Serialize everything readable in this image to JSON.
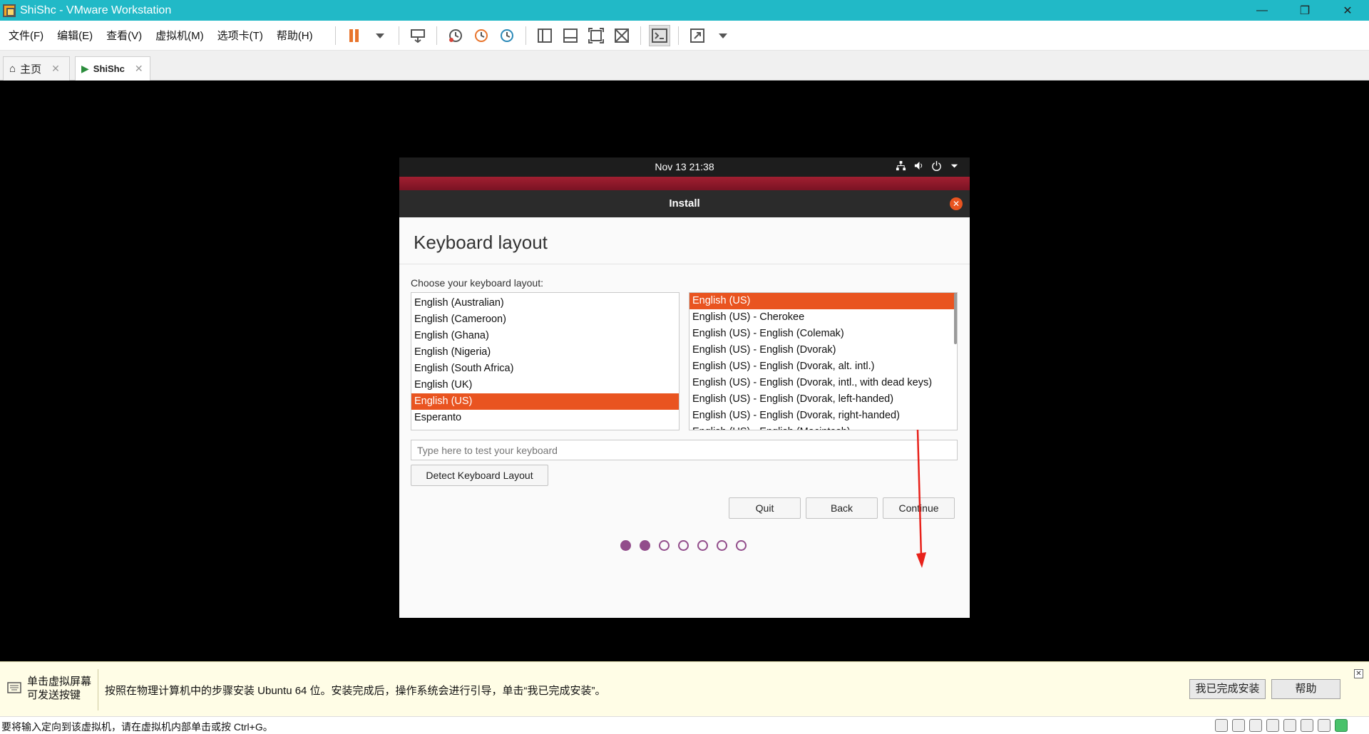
{
  "window": {
    "title": "ShiShc - VMware Workstation"
  },
  "menu": [
    "文件(F)",
    "编辑(E)",
    "查看(V)",
    "虚拟机(M)",
    "选项卡(T)",
    "帮助(H)"
  ],
  "tabs": {
    "home": "主页",
    "vm": "ShiShc"
  },
  "guest": {
    "clock": "Nov 13  21:38",
    "installer": {
      "header": "Install",
      "page_title": "Keyboard layout",
      "choose_label": "Choose your keyboard layout:",
      "layouts": [
        "English (Australian)",
        "English (Cameroon)",
        "English (Ghana)",
        "English (Nigeria)",
        "English (South Africa)",
        "English (UK)",
        "English (US)",
        "Esperanto"
      ],
      "selected_layout": "English (US)",
      "variants": [
        "English (US)",
        "English (US) - Cherokee",
        "English (US) - English (Colemak)",
        "English (US) - English (Dvorak)",
        "English (US) - English (Dvorak, alt. intl.)",
        "English (US) - English (Dvorak, intl., with dead keys)",
        "English (US) - English (Dvorak, left-handed)",
        "English (US) - English (Dvorak, right-handed)",
        "English (US) - English (Macintosh)"
      ],
      "selected_variant": "English (US)",
      "test_placeholder": "Type here to test your keyboard",
      "detect_button": "Detect Keyboard Layout",
      "quit_button": "Quit",
      "back_button": "Back",
      "continue_button": "Continue",
      "progress": {
        "current_step": 2,
        "total_steps": 7
      }
    }
  },
  "hint": {
    "left_line1": "单击虚拟屏幕",
    "left_line2": "可发送按键",
    "message": "按照在物理计算机中的步骤安装 Ubuntu 64 位。安装完成后，操作系统会进行引导，单击“我已完成安装”。",
    "done_button": "我已完成安装",
    "help_button": "帮助"
  },
  "status": {
    "text": "要将输入定向到该虚拟机，请在虚拟机内部单击或按 Ctrl+G。"
  },
  "colors": {
    "titlebar": "#21b9c7",
    "ubuntu_orange": "#e95420",
    "progress_purple": "#924d8b"
  }
}
